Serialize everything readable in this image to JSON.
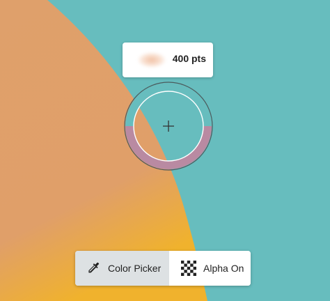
{
  "canvas": {
    "background_color": "#67bdbe",
    "shape_color": "#dfa06b",
    "shape_gradient_color": "#f0b22d"
  },
  "brush_tooltip": {
    "size_label": "400 pts",
    "preview_color": "#f2c2a4"
  },
  "color_picker_ring": {
    "sampled_color_top": "#67bdbe",
    "sampled_color_bottom": "#b98aa2",
    "icon": "crosshair-icon"
  },
  "toolbar": {
    "color_picker_label": "Color Picker",
    "color_picker_icon": "eyedropper-icon",
    "color_picker_active": true,
    "alpha_label": "Alpha On",
    "alpha_icon": "checkerboard-icon"
  }
}
